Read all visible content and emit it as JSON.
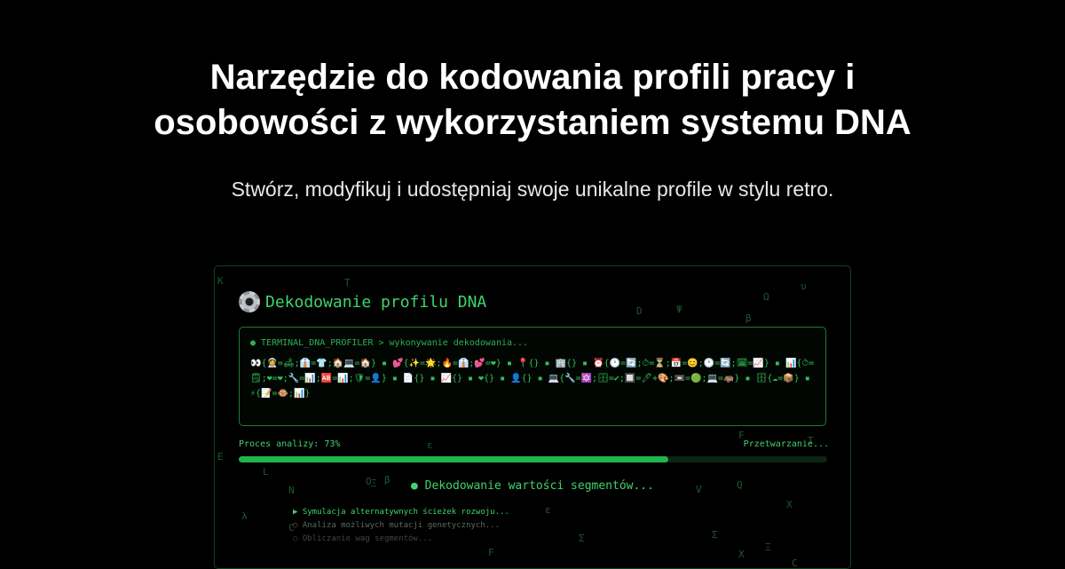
{
  "hero": {
    "title_line1": "Narzędzie do kodowania profili pracy i",
    "title_line2": "osobowości z wykorzystaniem systemu DNA",
    "subtitle": "Stwórz, modyfikuj i udostępniaj swoje unikalne profile w stylu retro."
  },
  "terminal": {
    "heading": "Dekodowanie profilu DNA",
    "heading_icon": "gear-icon",
    "prompt": "● TERMINAL_DNA_PROFILER > wykonywanie dekodowania...",
    "dna_code": "👀{👩‍🚀=🛋;👔=👕;🏠💻=🏠} ▪ 💕{✨=🌟;🔥=👔;💕=❤} ▪ 📍{} ▪ 🏢{} ▪ ⏰{🕐=🔄;⏱=⏳;📅=😊;🕐=🔄;🗓=📈} ▪ 📊{⏱=🗒;❤=❤;🔧=📊;🆎=📊;🛡=👤} ▪ 📄{} ▪ 📈{} ▪ ❤{} ▪ 👤{} ▪ 💻{🔧=🔯;🗄=✔;🔲=🖊+🎨;📼=🟢;💻=🦛} ▪ 🗄{☁=📦} ▪ ⚡{📝=🐵;📊}",
    "progress": {
      "label": "Proces analizy: 73%",
      "value": 73,
      "status": "Przetwarzanie..."
    },
    "segment_status": "● Dekodowanie wartości segmentów...",
    "log": [
      "▶ Symulacja alternatywnych ścieżek rozwoju...",
      "○ Analiza możliwych mutacji genetycznych...",
      "○ Obliczanie wag segmentów..."
    ],
    "matrix_chars": [
      "K",
      "T",
      "υ",
      "Ω",
      "D",
      "Ψ",
      "β",
      "ε",
      "F",
      "T",
      "E",
      "L",
      "Ξ",
      "O",
      "β",
      "N",
      "V",
      "Q",
      "λ",
      "ε",
      "X",
      "Σ",
      "Σ",
      "C",
      "F",
      "X",
      "Ξ",
      "C"
    ]
  },
  "colors": {
    "background": "#000000",
    "terminal_green": "#3fd46c",
    "progress_fill": "#22b34c",
    "border": "#1f7a36"
  }
}
